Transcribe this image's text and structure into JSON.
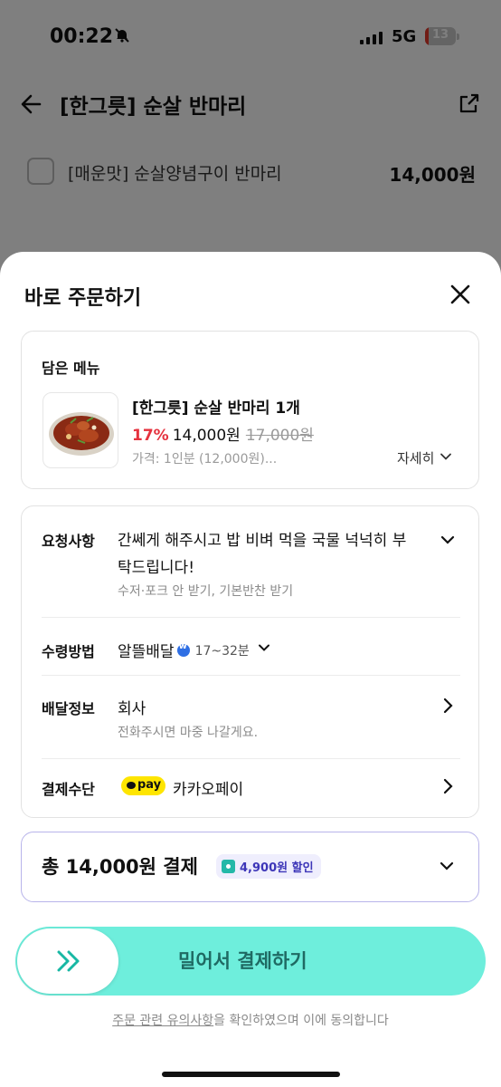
{
  "status_bar": {
    "time": "00:22",
    "network": "5G",
    "battery": "13",
    "battery_level": 0.13
  },
  "background": {
    "title": "[한그릇] 순살 반마리",
    "option": {
      "name": "[매운맛] 순살양념구이 반마리",
      "price": "14,000원"
    }
  },
  "sheet": {
    "title": "바로 주문하기",
    "menu_card": {
      "label": "담은 메뉴",
      "item_name": "[한그릇] 순살 반마리 1개",
      "discount_pct": "17%",
      "price": "14,000원",
      "original_price": "17,000원",
      "price_desc": "가격: 1인분 (12,000원)...",
      "detail_label": "자세히"
    },
    "info_card": {
      "request": {
        "label": "요청사항",
        "line1": "간쎄게 해주시고 밥 비벼 먹을 국물 넉넉히 부",
        "line2": "탁드립니다!",
        "sub": "수저·포크 안 받기, 기본반찬 받기"
      },
      "delivery_method": {
        "label": "수령방법",
        "value": "알뜰배달",
        "eta": "17~32분"
      },
      "delivery_info": {
        "label": "배달정보",
        "value": "회사",
        "sub": "전화주시면 마중 나갈게요."
      },
      "payment": {
        "label": "결제수단",
        "logo_text": "pay",
        "value": "카카오페이"
      }
    },
    "total": {
      "text": "총 14,000원 결제",
      "discount": "4,900원 할인"
    },
    "slide_button": {
      "label": "밀어서 결제하기"
    },
    "agreement": {
      "link": "주문 관련 유의사항",
      "rest": "을 확인하였으며 이에 동의합니다"
    }
  },
  "colors": {
    "accent_mint": "#6eeedc",
    "discount_red": "#e5323e",
    "kakao_yellow": "#fee500",
    "total_border": "#b8b4ea"
  }
}
